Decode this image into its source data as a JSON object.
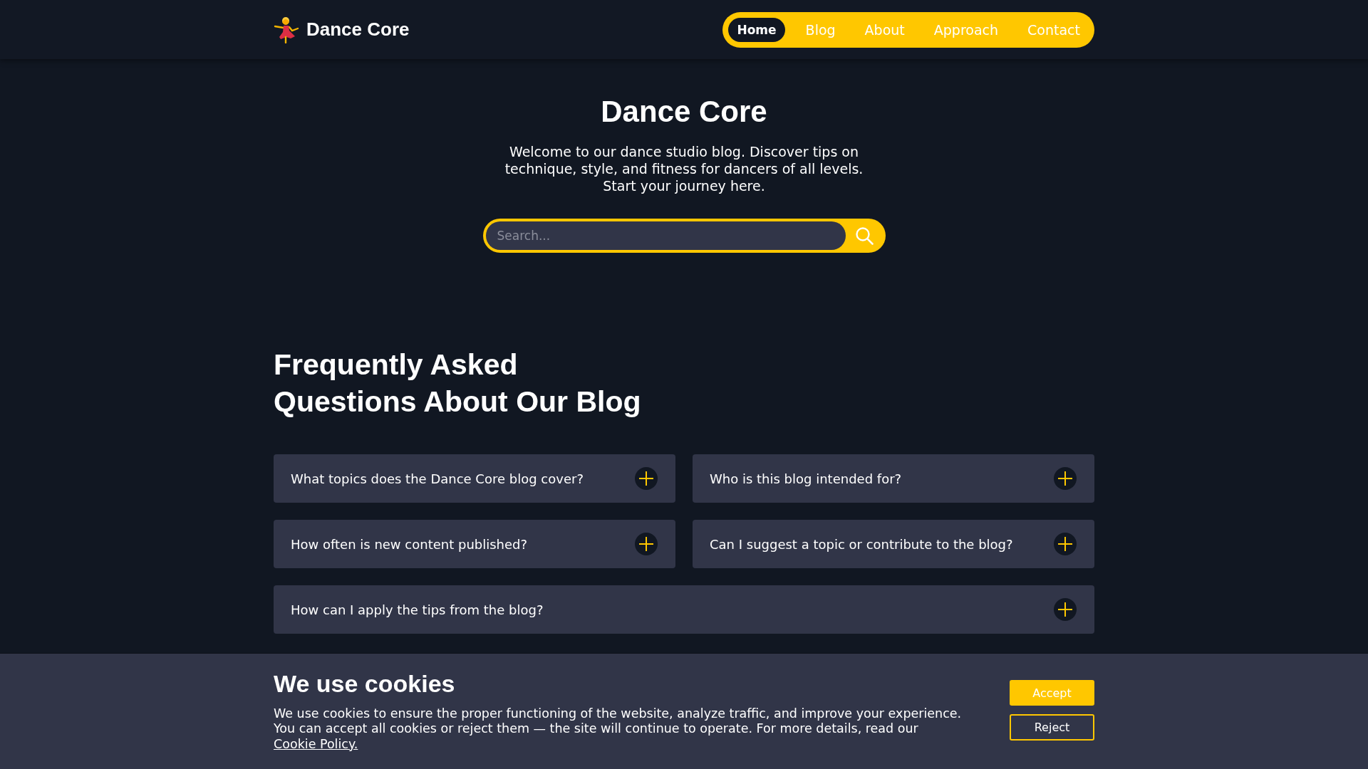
{
  "header": {
    "logo": "Dance Core",
    "nav": [
      {
        "label": "Home",
        "selected": true
      },
      {
        "label": "Blog",
        "selected": false
      },
      {
        "label": "About",
        "selected": false
      },
      {
        "label": "Approach",
        "selected": false
      },
      {
        "label": "Contact",
        "selected": false
      }
    ]
  },
  "hero": {
    "title": "Dance Core",
    "description": "Welcome to our dance studio blog. Discover tips on technique, style, and fitness for dancers of all levels. Start your journey here.",
    "search": {
      "placeholder": "Search..."
    }
  },
  "faq": {
    "title": "Frequently Asked Questions About Our Blog",
    "items": [
      {
        "question": "What topics does the Dance Core blog cover?",
        "expanded": false
      },
      {
        "question": "Who is this blog intended for?",
        "expanded": false
      },
      {
        "question": "How often is new content published?",
        "expanded": false
      },
      {
        "question": "Can I suggest a topic or contribute to the blog?",
        "expanded": false
      },
      {
        "question": "How can I apply the tips from the blog?",
        "expanded": false
      }
    ]
  },
  "cookie_banner": {
    "title": "We use cookies",
    "text": "We use cookies to ensure the proper functioning of the website, analyze traffic, and improve your experience. You can accept all cookies or reject them — the site will continue to operate. For more details, read our",
    "link": "Cookie Policy.",
    "buttons": [
      {
        "label": "Accept",
        "kind": "primary"
      },
      {
        "label": "Reject",
        "kind": "secondary"
      }
    ]
  }
}
